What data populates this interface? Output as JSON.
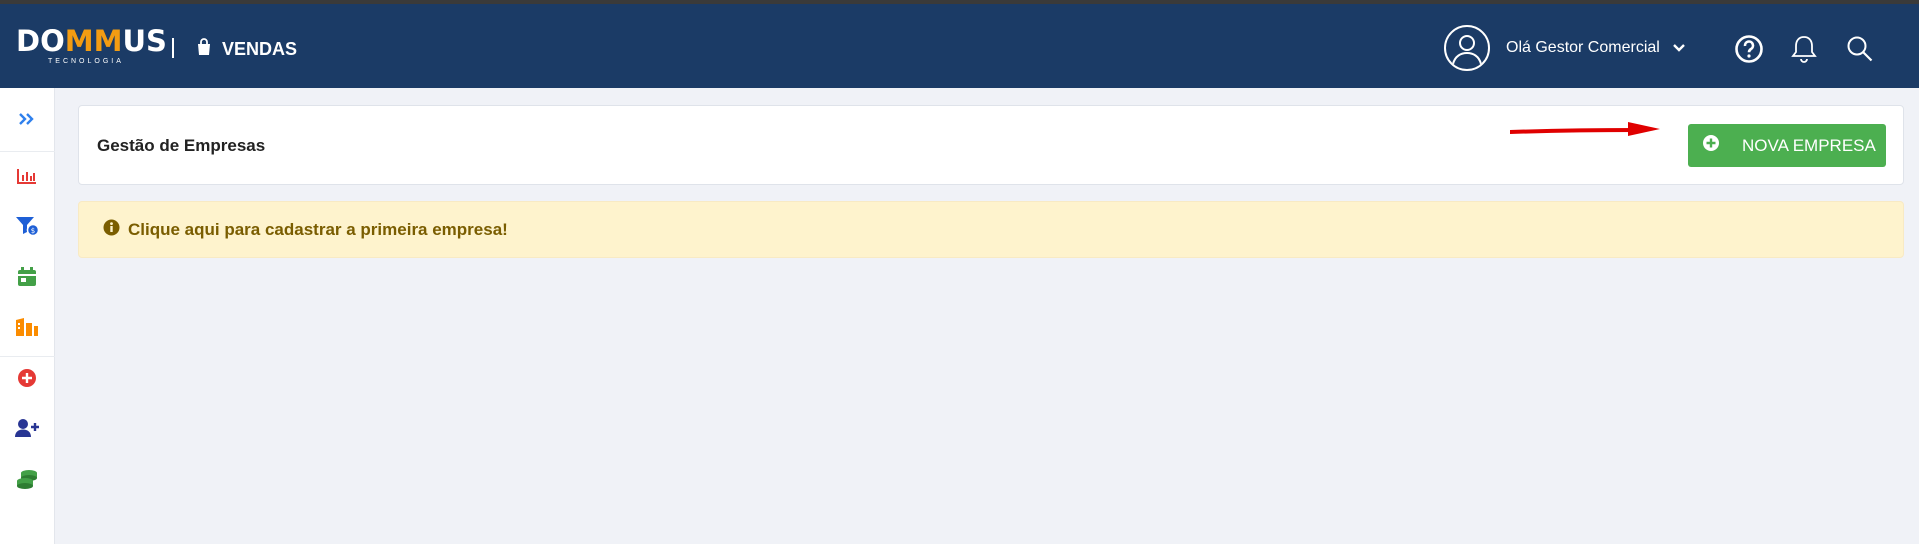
{
  "header": {
    "logo": {
      "text_before": "DO",
      "text_accent": "MM",
      "text_after": "US",
      "tagline": "TECNOLOGIA"
    },
    "module_label": "VENDAS",
    "greeting": "Olá Gestor Comercial",
    "icons": [
      "user-circle-icon",
      "chevron-down-icon",
      "help-icon",
      "bell-icon",
      "search-icon"
    ]
  },
  "sidebar": {
    "items": [
      {
        "name": "expand-icon",
        "color": "#2f80ed"
      },
      {
        "name": "chart-icon",
        "color": "#e53935"
      },
      {
        "name": "funnel-dollar-icon",
        "color": "#1e5fd6"
      },
      {
        "name": "calendar-icon",
        "color": "#43a047"
      },
      {
        "name": "building-icon",
        "color": "#fb8c00"
      },
      {
        "name": "plus-circle-icon",
        "color": "#e53935"
      },
      {
        "name": "user-plus-icon",
        "color": "#283593"
      },
      {
        "name": "coins-icon",
        "color": "#43a047"
      }
    ]
  },
  "main": {
    "card_title": "Gestão de Empresas",
    "new_button_label": "NOVA EMPRESA",
    "alert_text": "Clique aqui para cadastrar a primeira empresa!"
  },
  "colors": {
    "header_bg": "#1b3b66",
    "accent_orange": "#f39c12",
    "button_green": "#4caf50",
    "alert_bg": "#fef3cd",
    "alert_text": "#7a5d00",
    "annotation_arrow": "#e00000"
  }
}
